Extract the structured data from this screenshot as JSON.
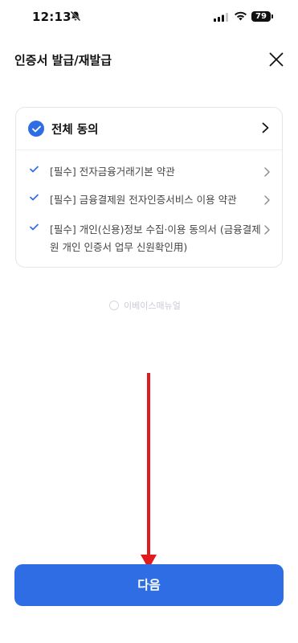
{
  "status_bar": {
    "time": "12:13",
    "battery": "79"
  },
  "header": {
    "title": "인증서 발급/재발급"
  },
  "agreement": {
    "all_label": "전체 동의",
    "terms": [
      {
        "label": "[필수] 전자금융거래기본 약관"
      },
      {
        "label": "[필수] 금융결제원 전자인증서비스 이용 약관"
      },
      {
        "label": "[필수] 개인(신용)정보 수집·이용 동의서 (금융결제원 개인 인증서 업무 신원확인用)"
      }
    ]
  },
  "watermark": "이베이스매뉴얼",
  "footer": {
    "next_label": "다음"
  },
  "colors": {
    "accent": "#2f6de5",
    "annotation_arrow": "#e01b1b"
  }
}
